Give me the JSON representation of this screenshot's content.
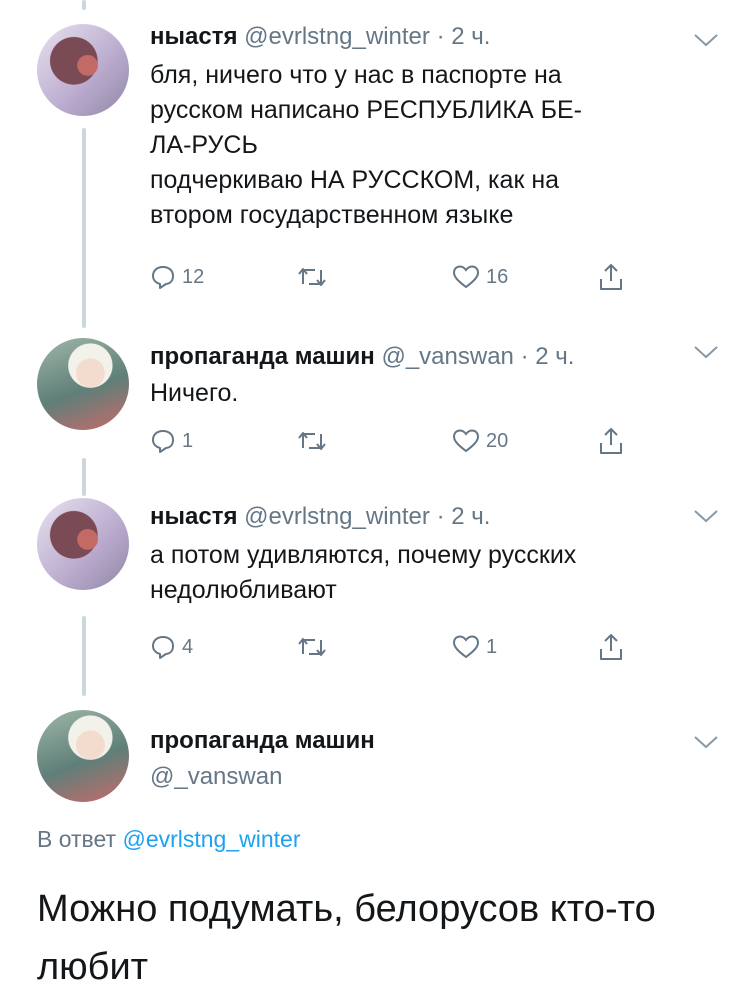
{
  "tweets": [
    {
      "name": "ныастя",
      "handle": "@evrlstng_winter",
      "time": "· 2 ч.",
      "lines": [
        "бля, ничего что у нас в паспорте на",
        "русском написано РЕСПУБЛИКА БЕ-",
        "ЛА-РУСЬ",
        "подчеркиваю НА РУССКОМ, как на",
        "втором государственном языке"
      ],
      "replies": "12",
      "likes": "16"
    },
    {
      "name": "пропаганда машин",
      "handle": "@_vanswan",
      "time": "· 2 ч.",
      "lines": [
        "Ничего."
      ],
      "replies": "1",
      "likes": "20"
    },
    {
      "name": "ныастя",
      "handle": "@evrlstng_winter",
      "time": "· 2 ч.",
      "lines": [
        "а потом удивляются, почему русских",
        "недолюбливают"
      ],
      "replies": "4",
      "likes": "1"
    }
  ],
  "main_tweet": {
    "name": "пропаганда машин",
    "handle": "@_vanswan",
    "reply_prefix": "В ответ",
    "reply_to": "@evrlstng_winter",
    "lines": [
      "Можно подумать, белорусов кто-то",
      "любит"
    ]
  },
  "icons": [
    "reply-icon",
    "retweet-icon",
    "like-icon",
    "share-icon",
    "chevron-down-icon"
  ],
  "colors": {
    "text": "#14171a",
    "muted": "#657786",
    "link": "#1da1f2",
    "thread": "#ccd6dd"
  }
}
